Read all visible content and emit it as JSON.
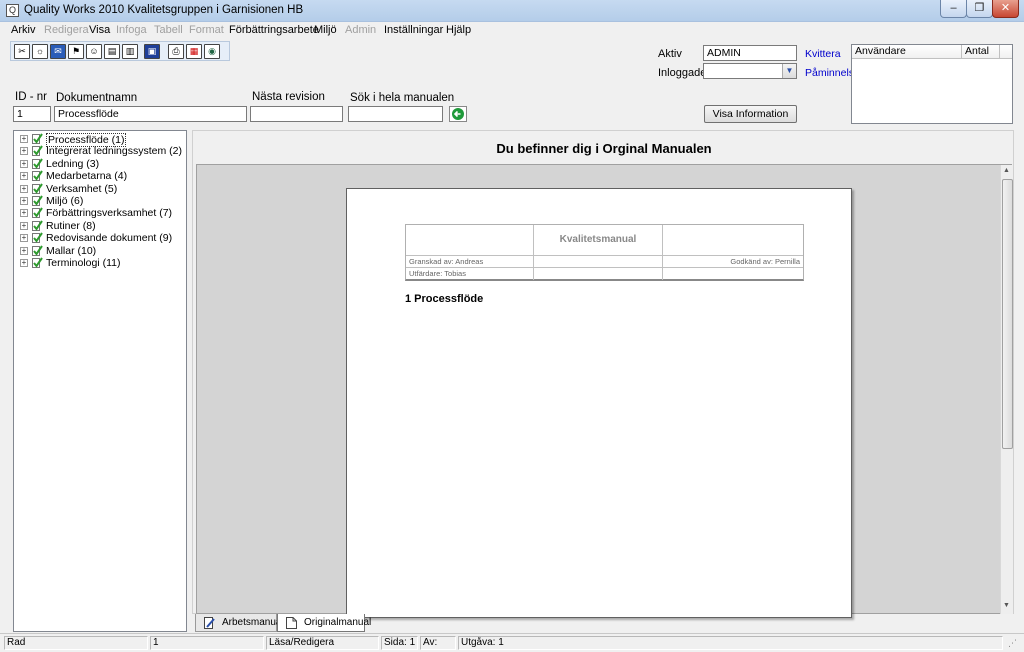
{
  "window": {
    "title": "Quality Works 2010 Kvalitetsgruppen i Garnisionen HB",
    "min_glyph": "–",
    "max_glyph": "❐",
    "close_glyph": "✕"
  },
  "menu": [
    {
      "label": "Arkiv",
      "enabled": true
    },
    {
      "label": "Redigera",
      "enabled": false
    },
    {
      "label": "Visa",
      "enabled": true
    },
    {
      "label": "Infoga",
      "enabled": false
    },
    {
      "label": "Tabell",
      "enabled": false
    },
    {
      "label": "Format",
      "enabled": false
    },
    {
      "label": "Förbättringsarbete",
      "enabled": true
    },
    {
      "label": "Miljö",
      "enabled": true
    },
    {
      "label": "Admin",
      "enabled": false
    },
    {
      "label": "Inställningar",
      "enabled": true
    },
    {
      "label": "Hjälp",
      "enabled": true
    }
  ],
  "toolbar_icons": [
    "tools-icon",
    "bulb-icon",
    "mail-icon",
    "flag-icon",
    "people-icon",
    "book-icon",
    "book-open-icon",
    "save-icon",
    "print-icon",
    "pdf-icon",
    "globe-icon"
  ],
  "form": {
    "id_label": "ID - nr",
    "id_value": "1",
    "docname_label": "Dokumentnamn",
    "docname_value": "Processflöde",
    "next_rev_label": "Nästa revision",
    "next_rev_value": "",
    "search_label": "Sök i hela manualen",
    "search_value": ""
  },
  "user_panel": {
    "aktiv_label": "Aktiv",
    "aktiv_value": "ADMIN",
    "inloggade_label": "Inloggade",
    "inloggade_value": "",
    "kvittera_link": "Kvittera",
    "paminnelse_link": "Påminnelse",
    "visa_info_button": "Visa Information",
    "col_user": "Användare",
    "col_count": "Antal"
  },
  "tree": [
    {
      "label": "Processflöde (1)",
      "selected": true
    },
    {
      "label": "Integrerat ledningssystem (2)",
      "selected": false
    },
    {
      "label": "Ledning (3)",
      "selected": false
    },
    {
      "label": "Medarbetarna (4)",
      "selected": false
    },
    {
      "label": "Verksamhet (5)",
      "selected": false
    },
    {
      "label": "Miljö (6)",
      "selected": false
    },
    {
      "label": "Förbättringsverksamhet (7)",
      "selected": false
    },
    {
      "label": "Rutiner (8)",
      "selected": false
    },
    {
      "label": "Redovisande dokument (9)",
      "selected": false
    },
    {
      "label": "Mallar (10)",
      "selected": false
    },
    {
      "label": "Terminologi (11)",
      "selected": false
    }
  ],
  "document": {
    "heading": "Du befinner dig i Orginal Manualen",
    "header_title": "Kvalitetsmanual",
    "granskad": "Granskad av: Andreas",
    "godkand": "Godkänd av: Pernilla",
    "utfardare": "Utfärdare: Tobias",
    "section": "1 Processflöde"
  },
  "tabs": [
    {
      "label": "Arbetsmanual",
      "active": false
    },
    {
      "label": "Originalmanual",
      "active": true
    }
  ],
  "status": {
    "rad": "Rad",
    "rad_value": "1",
    "mode": "Läsa/Redigera",
    "sida": "Sida: 1",
    "av": "Av:",
    "utgava": "Utgåva: 1"
  },
  "colors": {
    "check_green": "#2e9a2e",
    "search_go": "#1f9a3a",
    "link_blue": "#0000cc"
  }
}
